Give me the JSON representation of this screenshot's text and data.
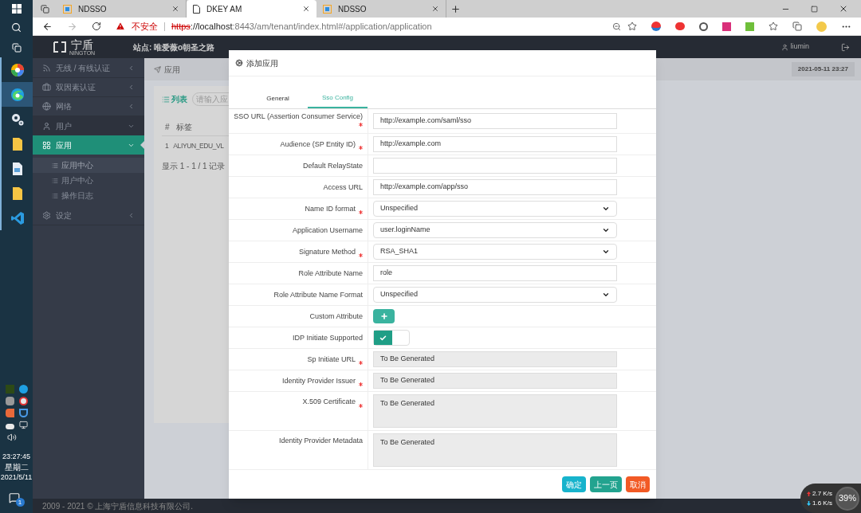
{
  "taskbar": {
    "apps": [
      {
        "selected": false
      },
      {
        "selected": true
      },
      {
        "selected": false
      },
      {
        "selected": false
      },
      {
        "selected": false
      },
      {
        "selected": false
      },
      {
        "selected": false
      }
    ],
    "time": "23:27:45",
    "weekday": "星期二",
    "date": "2021/5/11",
    "notifications": "1"
  },
  "browser": {
    "tabs": [
      {
        "title": "NDSSO",
        "selected": false
      },
      {
        "title": "DKEY AM",
        "selected": true
      },
      {
        "title": "NDSSO",
        "selected": false
      }
    ],
    "security_label": "不安全",
    "url_scheme": "https",
    "url_host": "://localhost",
    "url_path": ":8443/am/tenant/index.html#/application/application"
  },
  "app": {
    "logo": "宁盾",
    "logo_sub": "NINGTON",
    "site": "站点: 唯爱薇o朝圣之路",
    "user": "liumin",
    "breadcrumb": "应用",
    "datetime": "2021-05-11 23:27",
    "sidebar": [
      {
        "label": "无线 / 有线认证",
        "selected": false,
        "expanded": false
      },
      {
        "label": "双因素认证",
        "selected": false,
        "expanded": false
      },
      {
        "label": "网络",
        "selected": false,
        "expanded": false
      },
      {
        "label": "用户",
        "selected": false,
        "expanded": true
      },
      {
        "label": "应用",
        "selected": true,
        "expanded": true,
        "children": [
          {
            "label": "应用中心",
            "selected": true
          },
          {
            "label": "用户中心",
            "selected": false
          },
          {
            "label": "操作日志",
            "selected": false
          }
        ]
      },
      {
        "label": "设定",
        "selected": false,
        "expanded": false
      }
    ],
    "list": {
      "title": "列表",
      "search_placeholder": "请输入应",
      "columns": [
        "#",
        "标签"
      ],
      "rows": [
        [
          "1",
          "ALIYUN_EDU_VL"
        ]
      ],
      "summary": "显示 1 - 1 / 1 记录"
    },
    "footer": "2009 - 2021 © 上海宁盾信息科技有限公司."
  },
  "dialog": {
    "title": "添加应用",
    "tabs": [
      {
        "label": "General",
        "selected": false
      },
      {
        "label": "Sso Config",
        "selected": true
      }
    ],
    "fields": [
      {
        "label": "SSO URL (Assertion Consumer Service)",
        "required": true,
        "kind": "input",
        "value": "http://example.com/saml/sso"
      },
      {
        "label": "Audience (SP Entity ID)",
        "required": true,
        "kind": "input",
        "value": "http://example.com"
      },
      {
        "label": "Default RelayState",
        "required": false,
        "kind": "input"
      },
      {
        "label": "Access URL",
        "required": false,
        "kind": "input",
        "value": "http://example.com/app/sso"
      },
      {
        "label": "Name ID format",
        "required": true,
        "kind": "select",
        "value": "Unspecified"
      },
      {
        "label": "Application Username",
        "required": false,
        "kind": "select",
        "value": "user.loginName"
      },
      {
        "label": "Signature Method",
        "required": true,
        "kind": "select",
        "value": "RSA_SHA1"
      },
      {
        "label": "Role Attribute Name",
        "required": false,
        "kind": "input",
        "value": "role"
      },
      {
        "label": "Role Attribute Name Format",
        "required": false,
        "kind": "select",
        "value": "Unspecified"
      },
      {
        "label": "Custom Attribute",
        "required": false,
        "kind": "add"
      },
      {
        "label": "IDP Initiate Supported",
        "required": false,
        "kind": "toggle",
        "on": true
      },
      {
        "label": "Sp Initiate URL",
        "required": true,
        "kind": "readonly",
        "value": "To Be Generated"
      },
      {
        "label": "Identity Provider Issuer",
        "required": true,
        "kind": "readonly",
        "value": "To Be Generated"
      },
      {
        "label": "X.509 Certificate",
        "required": true,
        "kind": "textarea",
        "value": "To Be Generated"
      },
      {
        "label": "Identity Provider Metadata",
        "required": false,
        "kind": "textarea",
        "value": "To Be Generated"
      }
    ],
    "buttons": [
      {
        "label": "确定",
        "kind": "confirm"
      },
      {
        "label": "上一页",
        "kind": "prev"
      },
      {
        "label": "取消",
        "kind": "cancel"
      }
    ]
  },
  "network_widget": {
    "upload": "2.7 K/s",
    "download": "1.6 K/s",
    "percent": "39%"
  }
}
